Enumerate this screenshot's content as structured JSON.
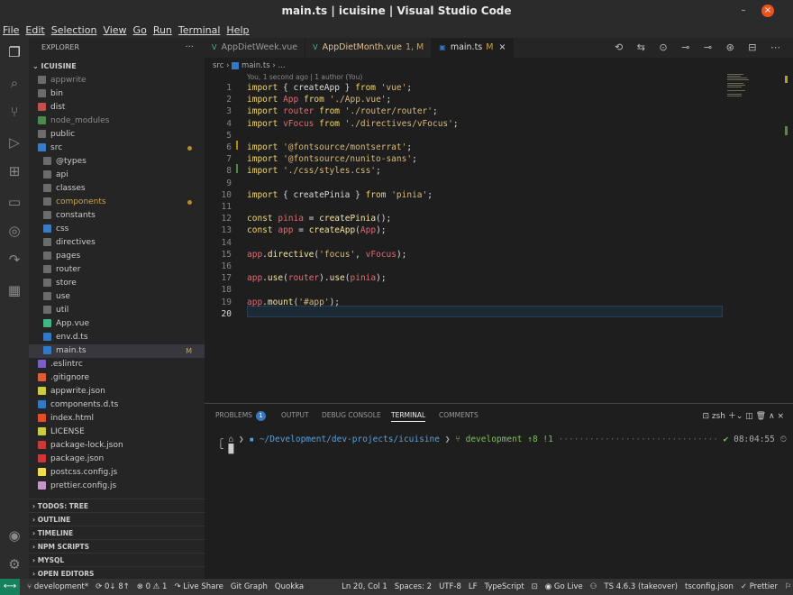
{
  "window": {
    "title": "main.ts | icuisine | Visual Studio Code"
  },
  "menu": [
    "File",
    "Edit",
    "Selection",
    "View",
    "Go",
    "Run",
    "Terminal",
    "Help"
  ],
  "sidebar": {
    "header": "EXPLORER",
    "root": "ICUISINE",
    "items": [
      {
        "label": "appwrite",
        "depth": 0,
        "icon": "folder",
        "dim": true
      },
      {
        "label": "bin",
        "depth": 0,
        "icon": "folder"
      },
      {
        "label": "dist",
        "depth": 0,
        "icon": "folder-red"
      },
      {
        "label": "node_modules",
        "depth": 0,
        "icon": "folder-green",
        "dim": true
      },
      {
        "label": "public",
        "depth": 0,
        "icon": "folder"
      },
      {
        "label": "src",
        "depth": 0,
        "icon": "folder-blue",
        "dot": true,
        "open": true
      },
      {
        "label": "@types",
        "depth": 1,
        "icon": "folder"
      },
      {
        "label": "api",
        "depth": 1,
        "icon": "folder"
      },
      {
        "label": "classes",
        "depth": 1,
        "icon": "folder"
      },
      {
        "label": "components",
        "depth": 1,
        "icon": "folder",
        "dot": true,
        "modified": true
      },
      {
        "label": "constants",
        "depth": 1,
        "icon": "folder"
      },
      {
        "label": "css",
        "depth": 1,
        "icon": "folder-blue"
      },
      {
        "label": "directives",
        "depth": 1,
        "icon": "folder"
      },
      {
        "label": "pages",
        "depth": 1,
        "icon": "folder"
      },
      {
        "label": "router",
        "depth": 1,
        "icon": "folder"
      },
      {
        "label": "store",
        "depth": 1,
        "icon": "folder"
      },
      {
        "label": "use",
        "depth": 1,
        "icon": "folder"
      },
      {
        "label": "util",
        "depth": 1,
        "icon": "folder"
      },
      {
        "label": "App.vue",
        "depth": 1,
        "icon": "vue"
      },
      {
        "label": "env.d.ts",
        "depth": 1,
        "icon": "ts"
      },
      {
        "label": "main.ts",
        "depth": 1,
        "icon": "ts",
        "selected": true,
        "mark": "M"
      },
      {
        "label": ".eslintrc",
        "depth": 0,
        "icon": "eslint"
      },
      {
        "label": ".gitignore",
        "depth": 0,
        "icon": "git"
      },
      {
        "label": "appwrite.json",
        "depth": 0,
        "icon": "json"
      },
      {
        "label": "components.d.ts",
        "depth": 0,
        "icon": "ts"
      },
      {
        "label": "index.html",
        "depth": 0,
        "icon": "html"
      },
      {
        "label": "LICENSE",
        "depth": 0,
        "icon": "license"
      },
      {
        "label": "package-lock.json",
        "depth": 0,
        "icon": "npm"
      },
      {
        "label": "package.json",
        "depth": 0,
        "icon": "npm"
      },
      {
        "label": "postcss.config.js",
        "depth": 0,
        "icon": "js"
      },
      {
        "label": "prettier.config.js",
        "depth": 0,
        "icon": "prettier"
      }
    ],
    "sections": [
      "TODOS: TREE",
      "OUTLINE",
      "TIMELINE",
      "NPM SCRIPTS",
      "MYSQL",
      "OPEN EDITORS"
    ]
  },
  "tabs": [
    {
      "label": "AppDietWeek.vue",
      "icon": "V"
    },
    {
      "label": "AppDietMonth.vue",
      "status": "1, M",
      "icon": "V"
    },
    {
      "label": "main.ts",
      "status": "M",
      "icon": "TS",
      "active": true
    }
  ],
  "breadcrumb": {
    "folder": "src",
    "file": "main.ts",
    "rest": "..."
  },
  "blame": "You, 1 second ago | 1 author (You)",
  "code": [
    "import { createApp } from 'vue';",
    "import App from './App.vue';",
    "import router from './router/router';",
    "import vFocus from './directives/vFocus';",
    "",
    "import '@fontsource/montserrat';",
    "import '@fontsource/nunito-sans';",
    "import './css/styles.css';",
    "",
    "import { createPinia } from 'pinia';",
    "",
    "const pinia = createPinia();",
    "const app = createApp(App);",
    "",
    "app.directive('focus', vFocus);",
    "",
    "app.use(router).use(pinia);",
    "",
    "app.mount('#app');",
    ""
  ],
  "panel": {
    "tabs": [
      "PROBLEMS",
      "OUTPUT",
      "DEBUG CONSOLE",
      "TERMINAL",
      "COMMENTS"
    ],
    "problems_count": "1",
    "active": "TERMINAL",
    "shell": "zsh",
    "terminal": {
      "path": "~/Development/dev-projects/icuisine",
      "branch": "development",
      "status": "↑8 !1",
      "time": "08:04:55"
    }
  },
  "statusbar": {
    "branch": "development*",
    "sync": "0↓ 8↑",
    "errors": "0",
    "warnings": "1",
    "live_share": "Live Share",
    "git_graph": "Git Graph",
    "quokka": "Quokka",
    "position": "Ln 20, Col 1",
    "spaces": "Spaces: 2",
    "encoding": "UTF-8",
    "eol": "LF",
    "language": "TypeScript",
    "go_live": "Go Live",
    "ts_version": "TS 4.6.3 (takeover)",
    "tsconfig": "tsconfig.json",
    "prettier": "Prettier"
  },
  "colors": {
    "accent": "#16825d",
    "selection": "#37373d",
    "modified": "#c9a64d"
  }
}
